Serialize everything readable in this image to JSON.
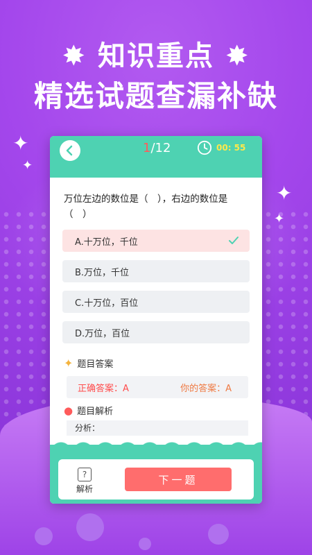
{
  "banner": {
    "line1": "知识重点",
    "line2": "精选试题查漏补缺"
  },
  "quiz": {
    "progress_current": "1",
    "progress_total": "/12",
    "timer": "00: 55",
    "question": "万位左边的数位是（　），右边的数位是（　）",
    "options": [
      {
        "label": "A.十万位，千位",
        "selected": true
      },
      {
        "label": "B.万位，千位"
      },
      {
        "label": "C.十万位，百位"
      },
      {
        "label": "D.万位，百位"
      }
    ],
    "answer_section_title": "题目答案",
    "correct_answer": "正确答案：A",
    "your_answer": "你的答案：A",
    "analysis_section_title": "题目解析",
    "analysis_text": "分析：",
    "help_label": "解析",
    "next_label": "下一题"
  },
  "colors": {
    "accent": "#4ed2b2",
    "next_button": "#ff6d6d",
    "background": "#a447ec"
  },
  "icons": [
    "back-arrow-icon",
    "clock-icon",
    "check-icon",
    "star-icon",
    "drop-icon",
    "help-icon"
  ]
}
